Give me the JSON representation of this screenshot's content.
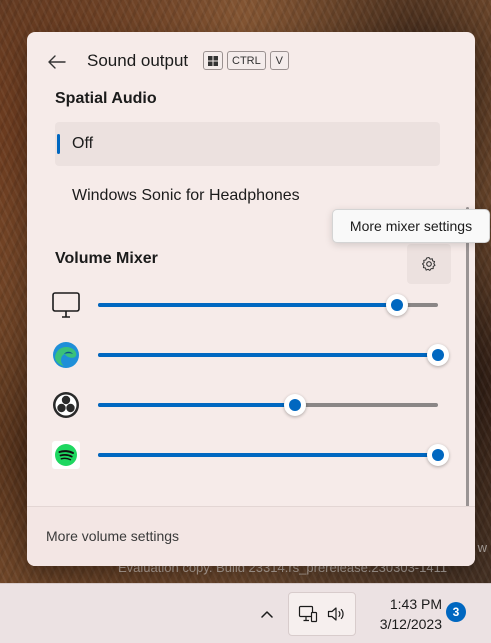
{
  "colors": {
    "accent": "#0067c0",
    "panel": "#f6ebe9"
  },
  "watermark": {
    "line": "Evaluation copy. Build 23314.rs_prerelease.230303-1411",
    "edge_char": "w"
  },
  "header": {
    "title": "Sound output",
    "keys": [
      "CTRL",
      "V"
    ],
    "icons": {
      "back": "back-arrow-icon",
      "win_key": "windows-key-icon"
    }
  },
  "spatial_audio": {
    "label": "Spatial Audio",
    "options": [
      {
        "label": "Off",
        "selected": true
      },
      {
        "label": "Windows Sonic for Headphones",
        "selected": false
      }
    ]
  },
  "mixer": {
    "label": "Volume Mixer",
    "settings_icon": "gear-icon",
    "tooltip": "More mixer settings",
    "apps": [
      {
        "icon": "monitor-icon",
        "volume": 0.88
      },
      {
        "icon": "edge-icon",
        "volume": 1.0
      },
      {
        "icon": "obs-icon",
        "volume": 0.58
      },
      {
        "icon": "spotify-icon",
        "volume": 1.0
      }
    ]
  },
  "footer": {
    "link": "More volume settings"
  },
  "taskbar": {
    "chevron_icon": "chevron-up-icon",
    "network_icon": "network-icon",
    "volume_icon": "speaker-icon",
    "time": "1:43 PM",
    "date": "3/12/2023",
    "notifications": "3"
  }
}
